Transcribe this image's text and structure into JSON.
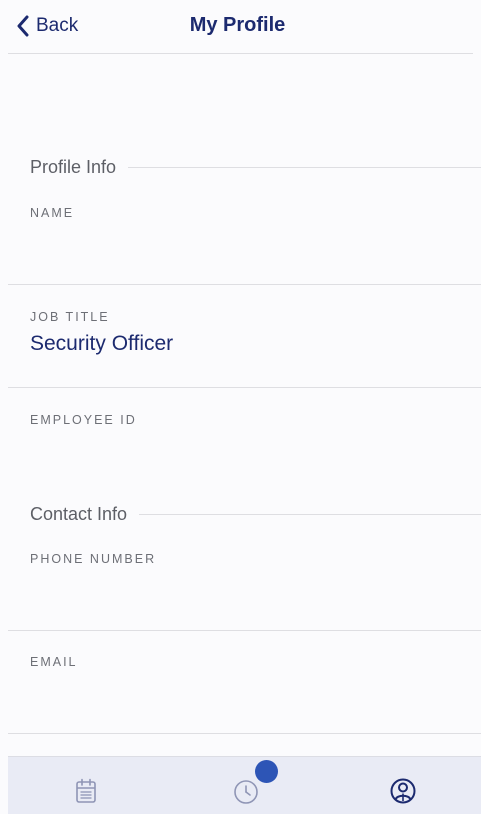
{
  "header": {
    "back_label": "Back",
    "title": "My Profile"
  },
  "profile_info": {
    "section_title": "Profile Info",
    "name_label": "NAME",
    "name_value": "",
    "job_title_label": "JOB TITLE",
    "job_title_value": "Security Officer",
    "employee_id_label": "EMPLOYEE ID",
    "employee_id_value": ""
  },
  "contact_info": {
    "section_title": "Contact Info",
    "phone_label": "PHONE NUMBER",
    "phone_value": "",
    "email_label": "EMAIL",
    "email_value": ""
  },
  "tab_bar": {
    "tabs": [
      {
        "icon": "calendar-icon"
      },
      {
        "icon": "clock-icon",
        "has_badge": true
      },
      {
        "icon": "profile-icon",
        "selected": true
      }
    ]
  },
  "colors": {
    "accent": "#1c2a6f",
    "badge": "#2d55b6",
    "tab_bar_bg": "#e9ebf5",
    "inactive_icon": "#8f95b5"
  }
}
